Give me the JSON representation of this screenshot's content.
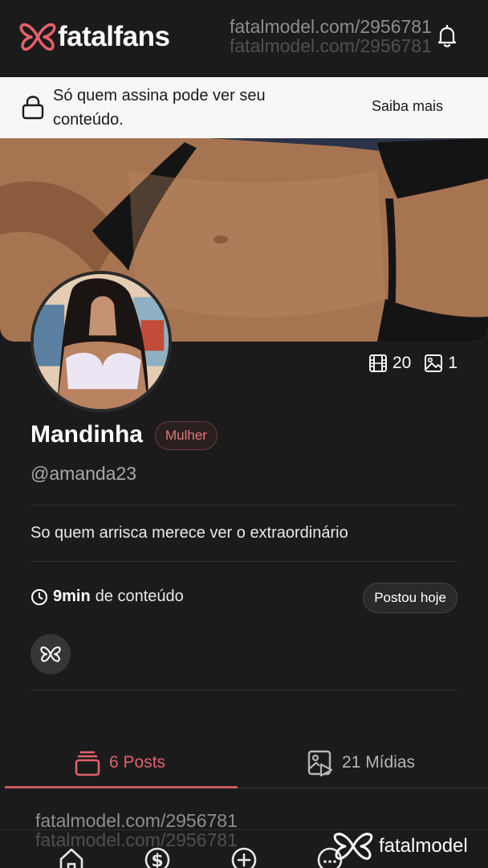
{
  "header": {
    "brand": "fatalfans",
    "watermark": "fatalmodel.com/2956781",
    "icons": {
      "logo": "butterfly-logo-icon",
      "notifications": "bell-icon"
    }
  },
  "lock_banner": {
    "icon": "lock-icon",
    "message": "Só quem assina pode ver seu conteúdo.",
    "link": "Saiba mais"
  },
  "profile": {
    "name": "Mandinha",
    "gender_badge": "Mulher",
    "handle": "@amanda23",
    "bio": "So quem arrisca merece ver o extraordinário",
    "video_count": "20",
    "photo_count": "1",
    "duration_value": "9min",
    "duration_label": "de conteúdo",
    "posted_badge": "Postou hoje"
  },
  "tabs": [
    {
      "label": "6 Posts",
      "icon": "stack-icon",
      "active": true
    },
    {
      "label": "21 Mídias",
      "icon": "media-icon",
      "active": false
    }
  ],
  "footer": {
    "watermark": "fatalmodel.com/2956781",
    "brand_watermark": "fatalmodel",
    "nav_icons": [
      "home-icon",
      "dollar-icon",
      "plus-icon",
      "more-icon"
    ]
  },
  "colors": {
    "accent": "#e0626a",
    "background": "#1b1b1c",
    "banner": "#f7f7f7"
  }
}
